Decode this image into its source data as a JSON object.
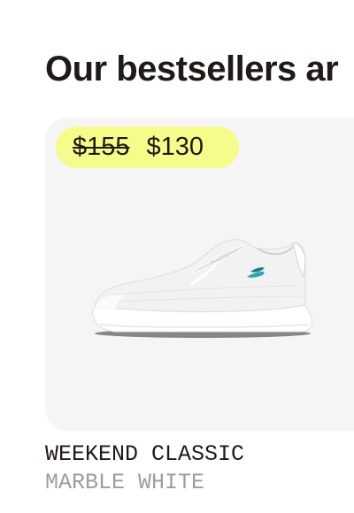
{
  "section": {
    "heading": "Our bestsellers ar"
  },
  "product": {
    "price_original": "$155",
    "price_sale": "$130",
    "image_icon": "sneaker-image",
    "name": "WEEKEND CLASSIC",
    "color": "MARBLE WHITE"
  },
  "colors": {
    "badge_background": "#f6fc8a",
    "card_background": "#f5f5f5",
    "text_primary": "#1f1a17",
    "text_muted": "#a19d98",
    "accent_teal": "#1b7f8e"
  }
}
